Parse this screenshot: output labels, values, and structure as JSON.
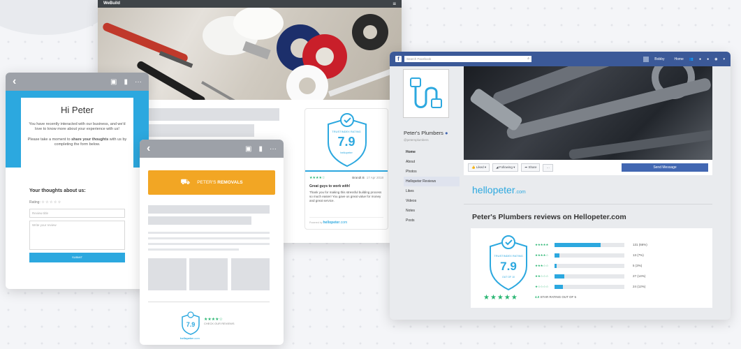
{
  "colors": {
    "brand_blue": "#2ca8df",
    "star_green": "#2bb673",
    "fb_blue": "#3b5998",
    "orange": "#f2a624"
  },
  "brand": {
    "hellopeter": "hellopeter",
    "hellopeter_suffix": ".com",
    "powered_by": "Powered by"
  },
  "email": {
    "hi": "Hi Peter",
    "intro": "You have recently interacted with our business, and we'd love to know more about your experience with us!",
    "cta_pre": "Please take a moment to ",
    "cta_bold": "share your thoughts",
    "cta_post": " with us by completing the form below.",
    "form_title": "Your thoughts about us:",
    "rating_label": "Rating",
    "title_placeholder": "Review title",
    "review_placeholder": "Write your review",
    "submit": "SUBMIT"
  },
  "website": {
    "brand": "WeBuild",
    "menu_icon": "hamburger-icon",
    "trustindex_label": "TRUSTINDEX RATING",
    "score": "7.9",
    "reviewer": "Brandt B",
    "review_date": "17 Apr 2018",
    "review_title": "Great guys to work with!",
    "review_body": "Thank you for making this stressful building process so much easier! You gave us great value for money and great service.",
    "stars": "★★★★☆"
  },
  "removals": {
    "company_plain": "PETER'S ",
    "company_bold": "REMOVALS",
    "score": "7.9",
    "stars": "★★★★☆",
    "tagline": "CHECK OUR REVIEWS"
  },
  "facebook": {
    "search_placeholder": "Search Facebook",
    "user": "Bobby",
    "home": "Home",
    "page_name": "Peter's Plumbers",
    "handle": "@petersplumbers",
    "nav": [
      "Home",
      "About",
      "Photos",
      "Hellopeter Reviews",
      "Likes",
      "Videos",
      "Notes",
      "Posts"
    ],
    "liked": "Liked",
    "following": "Following",
    "share": "Share",
    "more": "···",
    "send_message": "Send Message",
    "reviews_title": "Peter's Plumbers reviews on Hellopeter.com",
    "trustindex_label": "TRUSTINDEX RATING",
    "score": "7.9",
    "out_of": "OUT OF 10",
    "star_rating_value": "4.0",
    "star_rating_text": "STAR RATING OUT OF 5",
    "big_stars": "★★★★★",
    "distribution": [
      {
        "stars": "★★★★★",
        "count": "131 (66%)",
        "pct": 0.66
      },
      {
        "stars": "★★★★☆",
        "count": "13 (7%)",
        "pct": 0.07
      },
      {
        "stars": "★★★☆☆",
        "count": "5 (3%)",
        "pct": 0.03
      },
      {
        "stars": "★★☆☆☆",
        "count": "27 (14%)",
        "pct": 0.14
      },
      {
        "stars": "★☆☆☆☆",
        "count": "24 (12%)",
        "pct": 0.12
      }
    ]
  }
}
